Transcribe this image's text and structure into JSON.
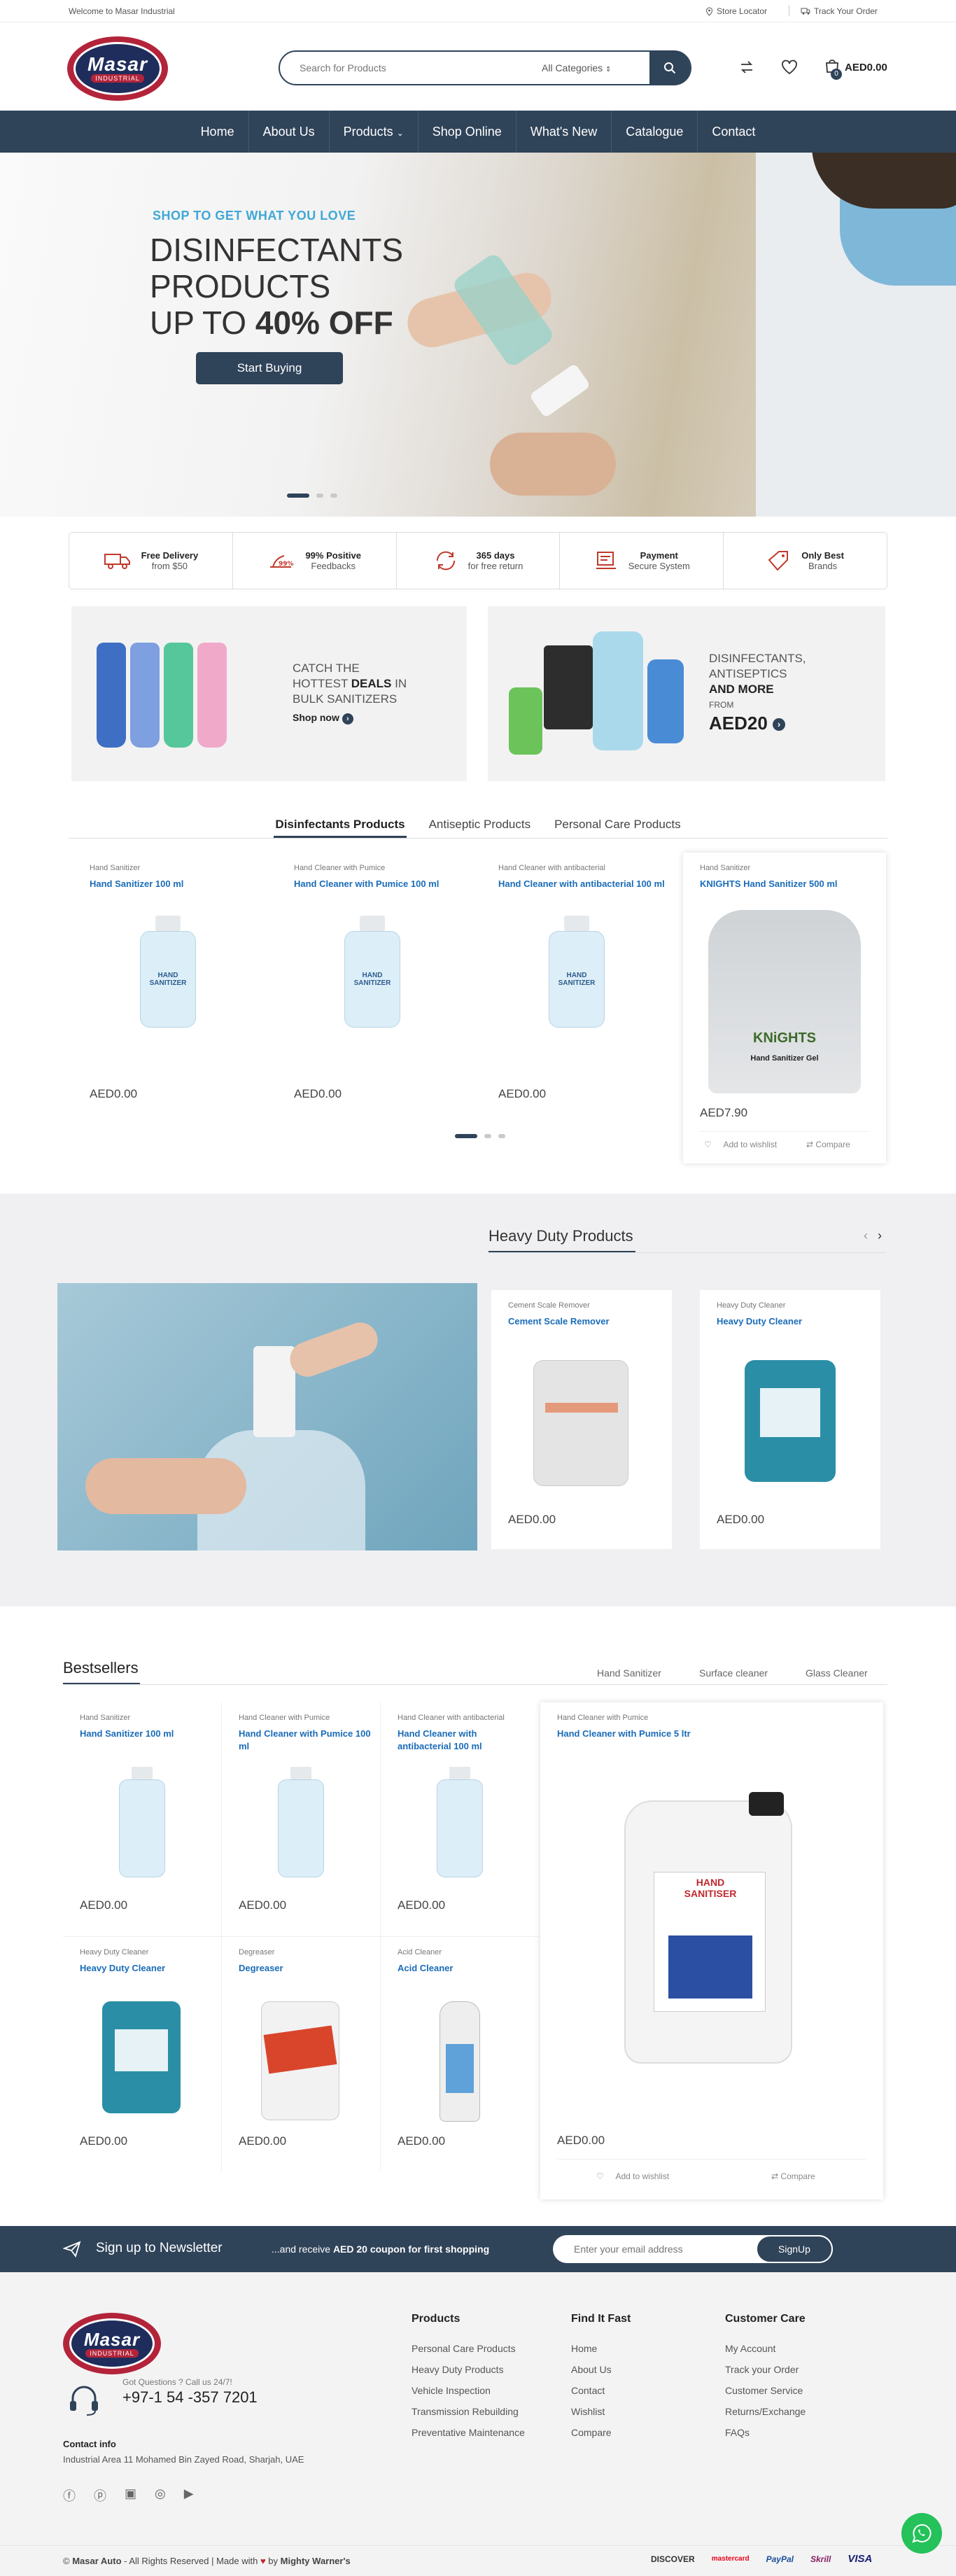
{
  "topbar": {
    "welcome": "Welcome to Masar Industrial",
    "store_locator": "Store Locator",
    "track_order": "Track Your Order"
  },
  "header": {
    "logo_text": "Masar",
    "logo_sub": "INDUSTRIAL",
    "search_placeholder": "Search for Products",
    "category": "All Categories",
    "cart_count": "0",
    "cart_total": "AED0.00"
  },
  "nav": [
    "Home",
    "About Us",
    "Products",
    "Shop Online",
    "What's New",
    "Catalogue",
    "Contact"
  ],
  "hero": {
    "pre": "SHOP TO GET WHAT YOU LOVE",
    "line1": "DISINFECTANTS",
    "line2": "PRODUCTS",
    "line3a": "UP TO ",
    "line3b": "40% OFF",
    "button": "Start Buying"
  },
  "features": [
    {
      "title": "Free Delivery",
      "sub": "from $50"
    },
    {
      "title": "99% Positive",
      "sub": "Feedbacks"
    },
    {
      "title": "365 days",
      "sub": "for free return"
    },
    {
      "title": "Payment",
      "sub": "Secure System"
    },
    {
      "title": "Only Best",
      "sub": "Brands"
    }
  ],
  "banner1": {
    "l1": "CATCH THE",
    "l2": "HOTTEST ",
    "l2b": "DEALS",
    "l2c": " IN",
    "l3": "BULK SANITIZERS",
    "link": "Shop now"
  },
  "banner2": {
    "l1": "DISINFECTANTS,",
    "l2": "ANTISEPTICS",
    "l3": "AND MORE",
    "l4": "FROM",
    "price": "AED20"
  },
  "tabs": [
    "Disinfectants Products",
    "Antiseptic Products",
    "Personal Care Products"
  ],
  "products": [
    {
      "cat": "Hand Sanitizer",
      "name": "Hand Sanitizer 100 ml",
      "price": "AED0.00"
    },
    {
      "cat": "Hand Cleaner with Pumice",
      "name": "Hand Cleaner with Pumice 100 ml",
      "price": "AED0.00"
    },
    {
      "cat": "Hand Cleaner with antibacterial",
      "name": "Hand Cleaner with antibacterial 100 ml",
      "price": "AED0.00"
    },
    {
      "cat": "Hand Sanitizer",
      "name": "KNIGHTS Hand Sanitizer 500 ml",
      "price": "AED7.90",
      "wishlist": "Add to wishlist",
      "compare": "Compare",
      "label1": "KNiGHTS",
      "label2": "Hand Sanitizer Gel"
    }
  ],
  "bottle_label": {
    "l1": "HAND",
    "l2": "SANITIZER"
  },
  "heavy": {
    "title": "Heavy Duty Products",
    "items": [
      {
        "cat": "Cement Scale Remover",
        "name": "Cement Scale Remover",
        "price": "AED0.00"
      },
      {
        "cat": "Heavy Duty Cleaner",
        "name": "Heavy Duty Cleaner",
        "price": "AED0.00"
      }
    ]
  },
  "bestsellers": {
    "title": "Bestsellers",
    "tabs": [
      "Hand Sanitizer",
      "Surface cleaner",
      "Glass Cleaner"
    ],
    "items": [
      {
        "cat": "Hand Sanitizer",
        "name": "Hand Sanitizer 100 ml",
        "price": "AED0.00"
      },
      {
        "cat": "Hand Cleaner with Pumice",
        "name": "Hand Cleaner with Pumice 100 ml",
        "price": "AED0.00"
      },
      {
        "cat": "Hand Cleaner with antibacterial",
        "name": "Hand Cleaner with antibacterial 100 ml",
        "price": "AED0.00"
      },
      {
        "cat": "Heavy Duty Cleaner",
        "name": "Heavy Duty Cleaner",
        "price": "AED0.00"
      },
      {
        "cat": "Degreaser",
        "name": "Degreaser",
        "price": "AED0.00"
      },
      {
        "cat": "Acid Cleaner",
        "name": "Acid Cleaner",
        "price": "AED0.00"
      }
    ],
    "big": {
      "cat": "Hand Cleaner with Pumice",
      "name": "Hand Cleaner with Pumice 5 ltr",
      "price": "AED0.00",
      "wishlist": "Add to wishlist",
      "compare": "Compare",
      "label1": "HAND",
      "label2": "SANITISER"
    }
  },
  "newsletter": {
    "title": "Sign up to Newsletter",
    "text1": "...and receive ",
    "text2": "AED 20 coupon for first shopping",
    "placeholder": "Enter your email address",
    "button": "SignUp"
  },
  "footer": {
    "question": "Got Questions ? Call us 24/7!",
    "phone": "+97-1 54 -357 7201",
    "contact_title": "Contact info",
    "address": "Industrial Area 11 Mohamed Bin Zayed Road, Sharjah, UAE",
    "cols": [
      {
        "title": "Products",
        "links": [
          "Personal Care Products",
          "Heavy Duty Products",
          "Vehicle Inspection",
          "Transmission Rebuilding",
          "Preventative Maintenance"
        ]
      },
      {
        "title": "Find It Fast",
        "links": [
          "Home",
          "About Us",
          "Contact",
          "Wishlist",
          "Compare"
        ]
      },
      {
        "title": "Customer Care",
        "links": [
          "My Account",
          "Track your Order",
          "Customer Service",
          "Returns/Exchange",
          "FAQs"
        ]
      }
    ],
    "copy1": "© ",
    "copy2": "Masar Auto",
    "copy3": " - All Rights Reserved | Made with ",
    "copy4": " by ",
    "copy5": "Mighty Warner's",
    "payments": [
      "DISCOVER",
      "mastercard",
      "PayPal",
      "Skrill",
      "VISA"
    ]
  },
  "colors": {
    "primary": "#2f4359",
    "accent": "#3fa8d6",
    "link": "#1a6cb8"
  }
}
